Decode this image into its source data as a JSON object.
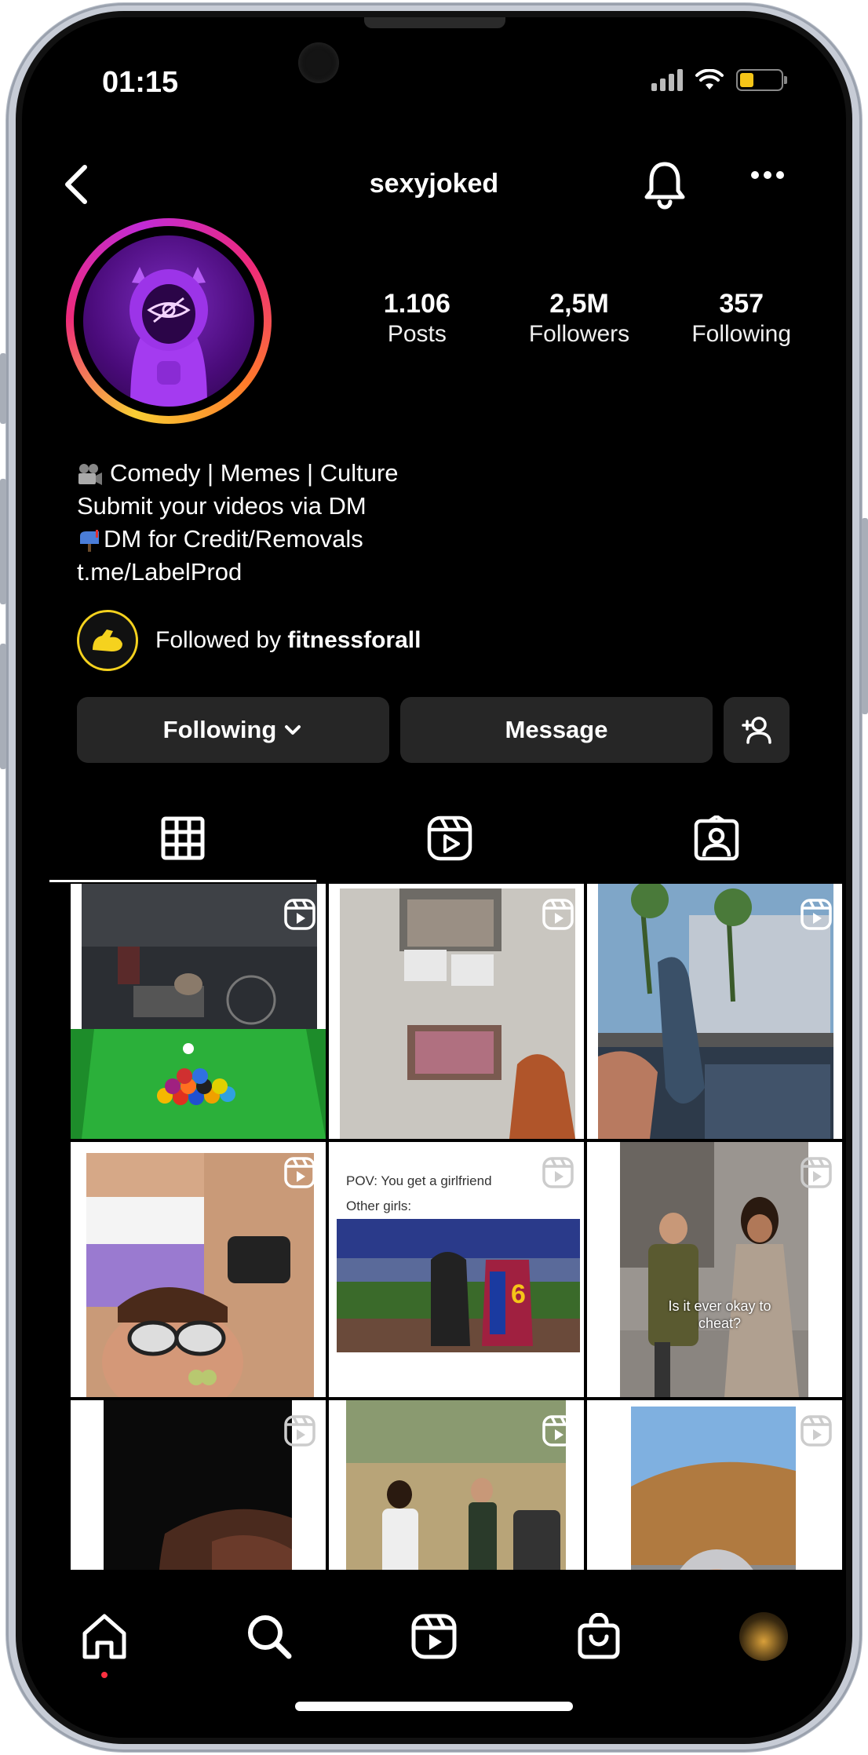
{
  "status_bar": {
    "time": "01:15"
  },
  "header": {
    "username": "sexyjoked"
  },
  "profile": {
    "stats": [
      {
        "value": "1.106",
        "label": "Posts"
      },
      {
        "value": "2,5M",
        "label": "Followers"
      },
      {
        "value": "357",
        "label": "Following"
      }
    ],
    "bio": [
      "Comedy | Memes | Culture",
      "Submit your videos via DM",
      "DM for Credit/Removals"
    ],
    "link": "t.me/LabelProd",
    "followed_by_prefix": "Followed by ",
    "followed_by_user": "fitnessforall"
  },
  "actions": {
    "following_label": "Following",
    "message_label": "Message"
  },
  "grid_posts": [
    {
      "caption": ""
    },
    {
      "caption": ""
    },
    {
      "caption": ""
    },
    {
      "caption": ""
    },
    {
      "caption_top": "POV: You get a girlfriend",
      "caption_bottom": "Other girls:"
    },
    {
      "caption": "Is it ever okay to cheat?"
    },
    {
      "caption": ""
    },
    {
      "caption": ""
    },
    {
      "caption": ""
    }
  ],
  "colors": {
    "background": "#000000",
    "button_bg": "#262626",
    "notification_dot": "#ff3040",
    "battery": "#f5c518"
  },
  "icons": {
    "battery_level": 0.35
  }
}
